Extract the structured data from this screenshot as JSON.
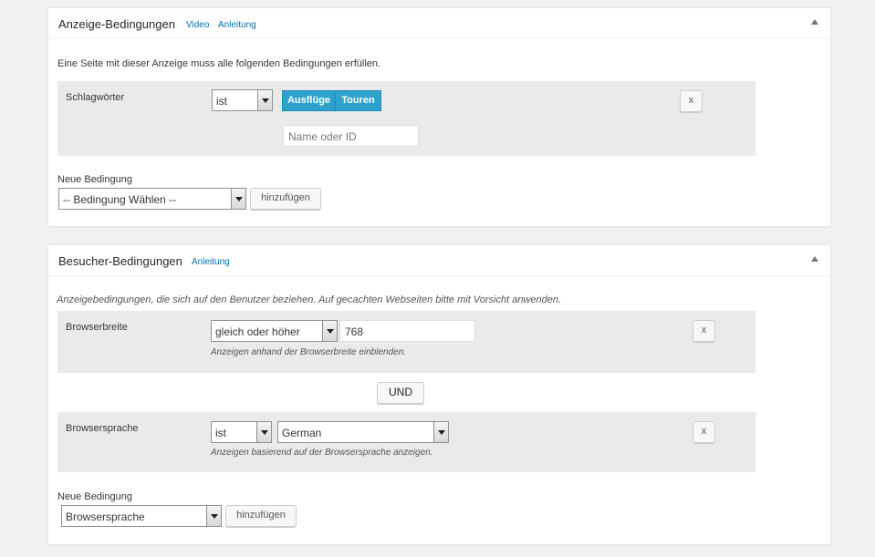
{
  "visibility_box": {
    "title": "Anzeige-Bedingungen",
    "video_link": "Video",
    "manual_link": "Anleitung",
    "description": "Eine Seite mit dieser Anzeige muss alle folgenden Bedingungen erfüllen.",
    "condition": {
      "label": "Schlagwörter",
      "operator": "ist",
      "tags": [
        "Ausflüge",
        "Touren"
      ],
      "search_placeholder": "Name oder ID",
      "remove_label": "x"
    },
    "new_condition": {
      "label": "Neue Bedingung",
      "select_value": "-- Bedingung Wählen --",
      "add_label": "hinzufügen"
    }
  },
  "visitor_box": {
    "title": "Besucher-Bedingungen",
    "manual_link": "Anleitung",
    "description": "Anzeigebedingungen, die sich auf den Benutzer beziehen. Auf gecachten Webseiten bitte mit Vorsicht anwenden.",
    "conditions": [
      {
        "label": "Browserbreite",
        "operator": "gleich oder höher",
        "value": "768",
        "help": "Anzeigen anhand der Browserbreite einblenden.",
        "remove_label": "x"
      },
      {
        "label": "Browsersprache",
        "operator": "ist",
        "value": "German",
        "help": "Anzeigen basierend auf der Browsersprache anzeigen.",
        "remove_label": "x"
      }
    ],
    "connector_label": "UND",
    "new_condition": {
      "label": "Neue Bedingung",
      "select_value": "Browsersprache",
      "add_label": "hinzufügen"
    }
  },
  "colors": {
    "page_bg": "#f1f1f1",
    "link": "#0073aa",
    "tag_bg": "#2ea2cc",
    "row_bg": "#eaeaea"
  }
}
